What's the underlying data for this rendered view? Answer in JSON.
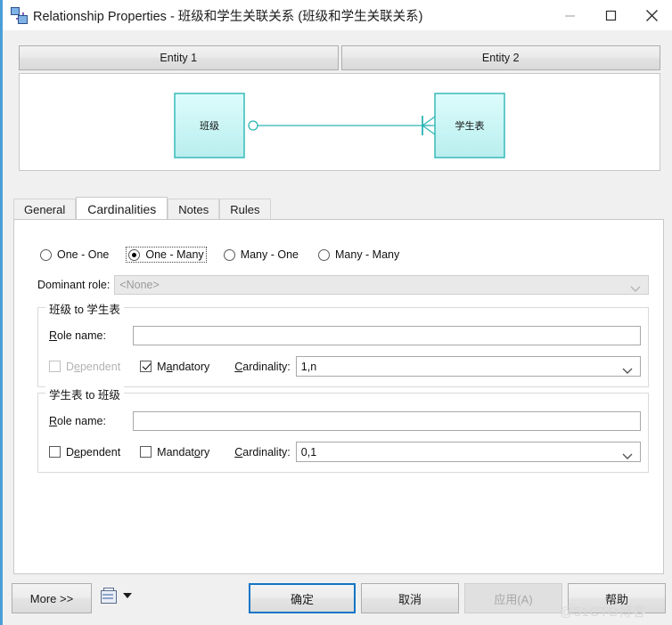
{
  "window": {
    "title": "Relationship Properties - 班级和学生关联关系 (班级和学生关联关系)",
    "app_icon": "relationship-icon",
    "controls": {
      "minimize": "minimize-icon",
      "maximize": "maximize-icon",
      "close": "close-icon"
    },
    "accent_color": "#4a9ed8"
  },
  "entity_bar": {
    "entity1_label": "Entity 1",
    "entity2_label": "Entity 2"
  },
  "diagram": {
    "left_entity": "班级",
    "right_entity": "学生表",
    "line_color": "#2bb5b5",
    "fill_color": "#c9f4f4",
    "left_symbol": "optional-one-circle",
    "right_symbol": "mandatory-many-crowsfoot"
  },
  "tabs": [
    {
      "label": "General",
      "active": false
    },
    {
      "label": "Cardinalities",
      "active": true
    },
    {
      "label": "Notes",
      "active": false
    },
    {
      "label": "Rules",
      "active": false
    }
  ],
  "cardinality_options": [
    {
      "label": "One - One",
      "mnemonic": "n",
      "checked": false,
      "focused": false
    },
    {
      "label": "One - Many",
      "mnemonic": "O",
      "checked": true,
      "focused": true
    },
    {
      "label": "Many - One",
      "mnemonic": "M",
      "checked": false,
      "focused": false
    },
    {
      "label": "Many - Many",
      "mnemonic": "y",
      "checked": false,
      "focused": false
    }
  ],
  "dominant_role": {
    "label": "Dominant role:",
    "value": "<None>",
    "disabled": true,
    "chevron": "chevron-down-icon"
  },
  "groups": [
    {
      "title": "班级 to 学生表",
      "role_name_label": "Role name:",
      "role_name_value": "",
      "dependent_label": "Dependent",
      "dependent_checked": false,
      "dependent_disabled": true,
      "mandatory_label": "Mandatory",
      "mandatory_checked": true,
      "mandatory_disabled": false,
      "cardinality_label": "Cardinality:",
      "cardinality_value": "1,n"
    },
    {
      "title": "学生表 to 班级",
      "role_name_label": "Role name:",
      "role_name_value": "",
      "dependent_label": "Dependent",
      "dependent_checked": false,
      "dependent_disabled": false,
      "mandatory_label": "Mandatory",
      "mandatory_checked": false,
      "mandatory_disabled": false,
      "cardinality_label": "Cardinality:",
      "cardinality_value": "0,1"
    }
  ],
  "footer": {
    "more_label": "More >>",
    "report_icon": "report-icon",
    "report_caret": "caret-down-icon",
    "ok_label": "确定",
    "cancel_label": "取消",
    "apply_label": "应用(A)",
    "help_label": "帮助",
    "apply_disabled": true,
    "ok_is_default": true
  },
  "watermark": "@51CTO博客"
}
